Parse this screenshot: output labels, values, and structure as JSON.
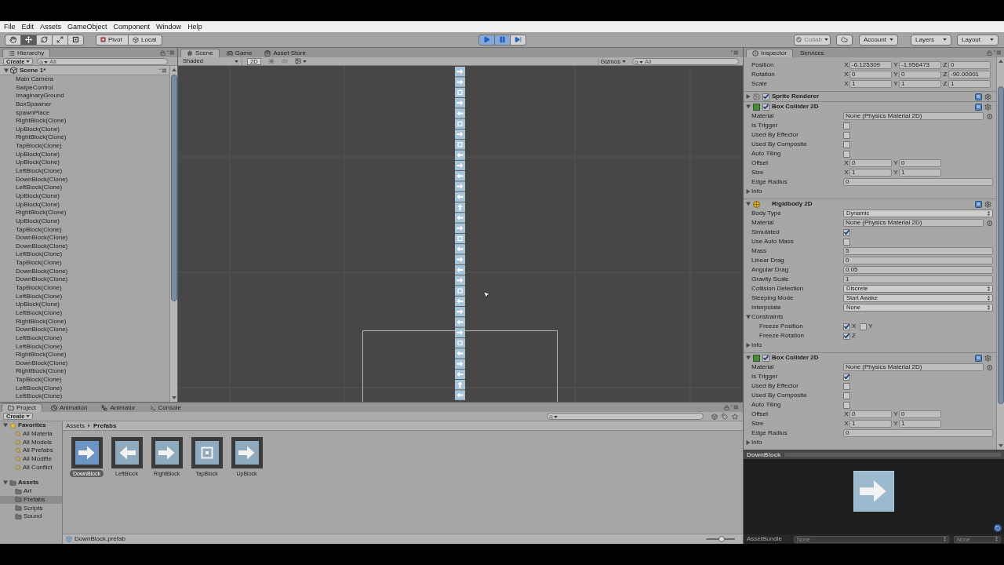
{
  "menu": [
    "File",
    "Edit",
    "Assets",
    "GameObject",
    "Component",
    "Window",
    "Help"
  ],
  "toolbar": {
    "tools": [
      {
        "kind": "hand",
        "selected": false
      },
      {
        "kind": "move",
        "selected": true
      },
      {
        "kind": "rotate",
        "selected": false
      },
      {
        "kind": "scale",
        "selected": false
      },
      {
        "kind": "rect",
        "selected": false
      }
    ],
    "pivot": "Pivot",
    "local": "Local",
    "playback": [
      {
        "kind": "play",
        "on": true
      },
      {
        "kind": "pause",
        "on": true
      },
      {
        "kind": "step",
        "on": false
      }
    ],
    "collab": {
      "label": "Collab",
      "disabled": true
    },
    "account": "Account",
    "layers": "Layers",
    "layout": "Layout"
  },
  "hierarchy": {
    "tabs": [
      {
        "kind": "hierarchy",
        "label": "Hierarchy",
        "selected": true
      }
    ],
    "create": "Create",
    "search_placeholder": "All",
    "scene": {
      "label": "Scene 1*",
      "expanded": true,
      "children": [
        {
          "label": "Main Camera"
        },
        {
          "label": "SwipeControl"
        },
        {
          "label": "ImaginaryGround"
        },
        {
          "label": "BoxSpawner"
        },
        {
          "label": "spawnPlace"
        },
        {
          "label": "RightBlock(Clone)"
        },
        {
          "label": "UpBlock(Clone)"
        },
        {
          "label": "RightBlock(Clone)"
        },
        {
          "label": "TapBlock(Clone)"
        },
        {
          "label": "UpBlock(Clone)"
        },
        {
          "label": "UpBlock(Clone)"
        },
        {
          "label": "LeftBlock(Clone)"
        },
        {
          "label": "DownBlock(Clone)"
        },
        {
          "label": "LeftBlock(Clone)"
        },
        {
          "label": "UpBlock(Clone)"
        },
        {
          "label": "UpBlock(Clone)"
        },
        {
          "label": "RightBlock(Clone)"
        },
        {
          "label": "UpBlock(Clone)"
        },
        {
          "label": "TapBlock(Clone)"
        },
        {
          "label": "DownBlock(Clone)"
        },
        {
          "label": "DownBlock(Clone)"
        },
        {
          "label": "LeftBlock(Clone)"
        },
        {
          "label": "TapBlock(Clone)"
        },
        {
          "label": "DownBlock(Clone)"
        },
        {
          "label": "DownBlock(Clone)"
        },
        {
          "label": "TapBlock(Clone)"
        },
        {
          "label": "LeftBlock(Clone)"
        },
        {
          "label": "UpBlock(Clone)"
        },
        {
          "label": "LeftBlock(Clone)"
        },
        {
          "label": "RightBlock(Clone)"
        },
        {
          "label": "DownBlock(Clone)"
        },
        {
          "label": "LeftBlock(Clone)"
        },
        {
          "label": "LeftBlock(Clone)"
        },
        {
          "label": "RightBlock(Clone)"
        },
        {
          "label": "DownBlock(Clone)"
        },
        {
          "label": "RightBlock(Clone)"
        },
        {
          "label": "TapBlock(Clone)"
        },
        {
          "label": "LeftBlock(Clone)"
        },
        {
          "label": "LeftBlock(Clone)"
        }
      ]
    }
  },
  "scene_view": {
    "tabs": [
      {
        "kind": "scene",
        "label": "Scene",
        "selected": true
      },
      {
        "kind": "game",
        "label": "Game",
        "selected": false
      },
      {
        "kind": "store",
        "label": "Asset Store",
        "selected": false
      }
    ],
    "shading": "Shaded",
    "mode_2d": {
      "label": "2D",
      "on": true
    },
    "gizmos": "Gizmos",
    "search_placeholder": "All"
  },
  "inspector": {
    "tabs": [
      {
        "kind": "inspector",
        "label": "Inspector",
        "selected": true
      },
      {
        "kind": "services",
        "label": "Services",
        "selected": false
      }
    ],
    "transform": [
      {
        "kind": "vector",
        "label": "Position",
        "values": [
          {
            "axis": "X",
            "value": "-6.125309"
          },
          {
            "axis": "Y",
            "value": "-1.956473"
          },
          {
            "axis": "Z",
            "value": "0"
          }
        ]
      },
      {
        "kind": "vector",
        "label": "Rotation",
        "values": [
          {
            "axis": "X",
            "value": "0"
          },
          {
            "axis": "Y",
            "value": "0"
          },
          {
            "axis": "Z",
            "value": "-90.00001"
          }
        ]
      },
      {
        "kind": "vector",
        "label": "Scale",
        "values": [
          {
            "axis": "X",
            "value": "1"
          },
          {
            "axis": "Y",
            "value": "1"
          },
          {
            "axis": "Z",
            "value": "1"
          }
        ]
      }
    ],
    "components": [
      {
        "kind": "sprite_renderer",
        "title": "Sprite Renderer",
        "expanded": false,
        "enabled": true
      },
      {
        "kind": "box_collider_2d",
        "title": "Box Collider 2D",
        "expanded": true,
        "enabled": true,
        "fields": [
          {
            "kind": "object",
            "label": "Material",
            "value": "None (Physics Material 2D)"
          },
          {
            "kind": "checkbox",
            "label": "Is Trigger",
            "checked": false
          },
          {
            "kind": "checkbox",
            "label": "Used By Effector",
            "checked": false
          },
          {
            "kind": "checkbox",
            "label": "Used By Composite",
            "checked": false
          },
          {
            "kind": "checkbox",
            "label": "Auto Tiling",
            "checked": false
          },
          {
            "kind": "vector",
            "label": "Offset",
            "values": [
              {
                "axis": "X",
                "value": "0"
              },
              {
                "axis": "Y",
                "value": "0"
              }
            ]
          },
          {
            "kind": "vector",
            "label": "Size",
            "values": [
              {
                "axis": "X",
                "value": "1"
              },
              {
                "axis": "Y",
                "value": "1"
              }
            ]
          },
          {
            "kind": "number",
            "label": "Edge Radius",
            "value": "0"
          },
          {
            "kind": "foldout",
            "label": "Info",
            "expanded": false
          }
        ]
      },
      {
        "kind": "rigidbody_2d",
        "title": "Rigidbody 2D",
        "expanded": true,
        "fields": [
          {
            "kind": "dropdown",
            "label": "Body Type",
            "value": "Dynamic"
          },
          {
            "kind": "object",
            "label": "Material",
            "value": "None (Physics Material 2D)"
          },
          {
            "kind": "checkbox",
            "label": "Simulated",
            "checked": true
          },
          {
            "kind": "checkbox",
            "label": "Use Auto Mass",
            "checked": false
          },
          {
            "kind": "number",
            "label": "Mass",
            "value": "5"
          },
          {
            "kind": "number",
            "label": "Linear Drag",
            "value": "0"
          },
          {
            "kind": "number",
            "label": "Angular Drag",
            "value": "0.05"
          },
          {
            "kind": "number",
            "label": "Gravity Scale",
            "value": "1"
          },
          {
            "kind": "dropdown",
            "label": "Collision Detection",
            "value": "Discrete"
          },
          {
            "kind": "dropdown",
            "label": "Sleeping Mode",
            "value": "Start Awake"
          },
          {
            "kind": "dropdown",
            "label": "Interpolate",
            "value": "None"
          },
          {
            "kind": "foldout",
            "label": "Constraints",
            "expanded": true,
            "children": [
              {
                "kind": "constraint",
                "label": "Freeze Position",
                "axes": [
                  {
                    "axis": "X",
                    "checked": true
                  },
                  {
                    "axis": "Y",
                    "checked": false
                  }
                ]
              },
              {
                "kind": "constraint",
                "label": "Freeze Rotation",
                "axes": [
                  {
                    "axis": "Z",
                    "checked": true
                  }
                ]
              }
            ]
          },
          {
            "kind": "foldout",
            "label": "Info",
            "expanded": false
          }
        ]
      },
      {
        "kind": "box_collider_2d",
        "title": "Box Collider 2D",
        "expanded": true,
        "enabled": true,
        "fields": [
          {
            "kind": "object",
            "label": "Material",
            "value": "None (Physics Material 2D)"
          },
          {
            "kind": "checkbox",
            "label": "Is Trigger",
            "checked": true
          },
          {
            "kind": "checkbox",
            "label": "Used By Effector",
            "checked": false
          },
          {
            "kind": "checkbox",
            "label": "Used By Composite",
            "checked": false
          },
          {
            "kind": "checkbox",
            "label": "Auto Tiling",
            "checked": false
          },
          {
            "kind": "vector",
            "label": "Offset",
            "values": [
              {
                "axis": "X",
                "value": "0"
              },
              {
                "axis": "Y",
                "value": "0"
              }
            ]
          },
          {
            "kind": "vector",
            "label": "Size",
            "values": [
              {
                "axis": "X",
                "value": "1"
              },
              {
                "axis": "Y",
                "value": "1"
              }
            ]
          },
          {
            "kind": "number",
            "label": "Edge Radius",
            "value": "0"
          },
          {
            "kind": "foldout",
            "label": "Info",
            "expanded": false
          }
        ]
      }
    ]
  },
  "preview": {
    "title": "DownBlock",
    "kind": "arrow_right",
    "asset_bundle_label": "AssetBundle",
    "bundle": "None",
    "variant": "None"
  },
  "project": {
    "tabs": [
      {
        "kind": "project",
        "label": "Project",
        "selected": true
      },
      {
        "kind": "animation",
        "label": "Animation",
        "selected": false
      },
      {
        "kind": "animator",
        "label": "Animator",
        "selected": false
      },
      {
        "kind": "console",
        "label": "Console",
        "selected": false
      }
    ],
    "create": "Create",
    "tree": [
      {
        "label": "Favorites",
        "kind": "favorites",
        "expanded": true,
        "selected": false,
        "children": [
          {
            "label": "All Materia",
            "kind": "search",
            "selected": false
          },
          {
            "label": "All Models",
            "kind": "search",
            "selected": false
          },
          {
            "label": "All Prefabs",
            "kind": "search",
            "selected": false
          },
          {
            "label": "All Modifie",
            "kind": "search",
            "selected": false
          },
          {
            "label": "All Conflict",
            "kind": "search",
            "selected": false
          }
        ]
      },
      {
        "label": "Assets",
        "kind": "folder",
        "expanded": true,
        "selected": false,
        "children": [
          {
            "label": "Art",
            "kind": "folder",
            "selected": false
          },
          {
            "label": "Prefabs",
            "kind": "folder",
            "selected": true
          },
          {
            "label": "Scripts",
            "kind": "folder",
            "selected": false
          },
          {
            "label": "Sound",
            "kind": "folder",
            "selected": false
          }
        ]
      }
    ],
    "breadcrumb": [
      "Assets",
      "Prefabs"
    ],
    "assets": [
      {
        "name": "DownBlock",
        "kind": "arrow_right",
        "selected": true
      },
      {
        "name": "LeftBlock",
        "kind": "arrow_left",
        "selected": false
      },
      {
        "name": "RightBlock",
        "kind": "arrow_right",
        "selected": false
      },
      {
        "name": "TapBlock",
        "kind": "square",
        "selected": false
      },
      {
        "name": "UpBlock",
        "kind": "arrow_right",
        "selected": false
      }
    ],
    "status": "DownBlock.prefab",
    "zoom": {
      "level": 0.55
    }
  }
}
